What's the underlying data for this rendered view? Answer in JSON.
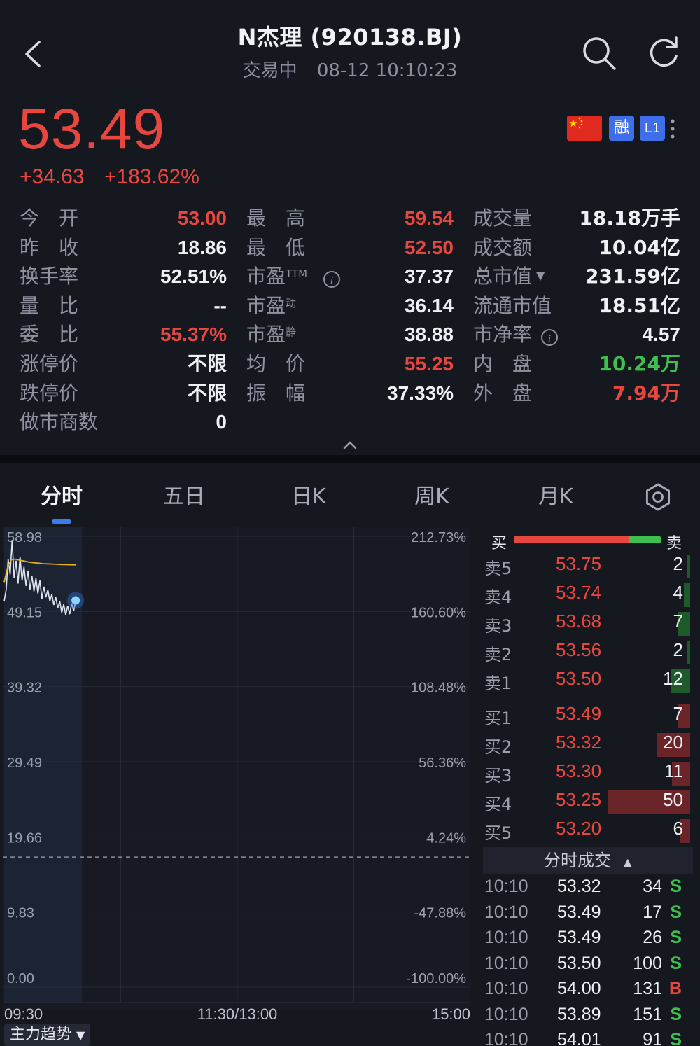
{
  "header": {
    "title": "N杰理 (920138.BJ)",
    "status": "交易中",
    "datetime": "08-12 10:10:23"
  },
  "quote": {
    "price": "53.49",
    "change": "+34.63",
    "change_pct": "+183.62%",
    "badges": {
      "margin": "融",
      "level": "L1"
    },
    "price_color": "#e8473f"
  },
  "stats": {
    "col1": [
      {
        "label": "今　开",
        "value": "53.00",
        "color": "red"
      },
      {
        "label": "昨　收",
        "value": "18.86",
        "color": "white"
      },
      {
        "label": "换手率",
        "value": "52.51%",
        "color": "white"
      },
      {
        "label": "量　比",
        "value": "--",
        "color": "white"
      },
      {
        "label": "委　比",
        "value": "55.37%",
        "color": "red"
      },
      {
        "label": "涨停价",
        "value": "不限",
        "color": "white"
      },
      {
        "label": "跌停价",
        "value": "不限",
        "color": "white"
      },
      {
        "label": "做市商数",
        "value": "0",
        "color": "white"
      }
    ],
    "col2": [
      {
        "label": "最　高",
        "value": "59.54",
        "color": "red"
      },
      {
        "label": "最　低",
        "value": "52.50",
        "color": "red"
      },
      {
        "label": "市盈",
        "sup": "TTM",
        "value": "37.37",
        "color": "white"
      },
      {
        "label": "市盈",
        "sup": "动",
        "value": "36.14",
        "color": "white"
      },
      {
        "label": "市盈",
        "sup": "静",
        "value": "38.88",
        "color": "white"
      },
      {
        "label": "均　价",
        "value": "55.25",
        "color": "red"
      },
      {
        "label": "振　幅",
        "value": "37.33%",
        "color": "white"
      }
    ],
    "col3": [
      {
        "label": "成交量",
        "value": "18.18万手",
        "color": "white"
      },
      {
        "label": "成交额",
        "value": "10.04亿",
        "color": "white"
      },
      {
        "label": "总市值",
        "value": "231.59亿",
        "color": "white"
      },
      {
        "label": "流通市值",
        "value": "18.51亿",
        "color": "white"
      },
      {
        "label": "市净率",
        "value": "4.57",
        "color": "white"
      },
      {
        "label": "内　盘",
        "value": "10.24万",
        "color": "green"
      },
      {
        "label": "外　盘",
        "value": "7.94万",
        "color": "red"
      }
    ]
  },
  "tabs": [
    "分时",
    "五日",
    "日K",
    "周K",
    "月K"
  ],
  "chart_data": {
    "type": "line",
    "y_left_ticks": [
      "58.98",
      "49.15",
      "39.32",
      "29.49",
      "19.66",
      "9.83",
      "0.00"
    ],
    "y_right_ticks": [
      "212.73%",
      "160.60%",
      "108.48%",
      "56.36%",
      "4.24%",
      "-47.88%",
      "-100.00%"
    ],
    "x_ticks": [
      "09:30",
      "11:30/13:00",
      "15:00"
    ],
    "ylim": [
      0,
      58.98
    ],
    "prev_close": 18.86,
    "session_minutes": 240,
    "price_series": [
      50.5,
      52.0,
      56.0,
      54.0,
      58.5,
      53.5,
      55.8,
      52.8,
      56.3,
      53.2,
      55.0,
      52.5,
      54.5,
      52.0,
      53.8,
      51.8,
      53.5,
      51.5,
      53.2,
      50.8,
      52.4,
      51.0,
      52.0,
      50.5,
      51.4,
      50.0,
      51.0,
      49.6,
      50.5,
      49.0,
      50.1,
      48.7,
      49.9,
      48.8,
      50.2,
      49.2,
      50.6
    ],
    "avg_series": [
      53.0,
      55.0,
      55.9,
      56.0,
      55.9,
      55.8,
      55.7,
      55.6,
      55.55,
      55.5,
      55.45,
      55.4,
      55.38,
      55.36,
      55.34,
      55.32,
      55.3,
      55.28,
      55.27,
      55.26,
      55.25
    ],
    "line_color": "#dfe3ee",
    "avg_color": "#e6b422"
  },
  "trend_button": "主力趋势",
  "orderbook": {
    "buy_label": "买",
    "sell_label": "卖",
    "buy_ratio": 0.78,
    "asks": [
      {
        "level": "卖5",
        "price": "53.75",
        "vol": "2",
        "vol_num": 2
      },
      {
        "level": "卖4",
        "price": "53.74",
        "vol": "4",
        "vol_num": 4
      },
      {
        "level": "卖3",
        "price": "53.68",
        "vol": "7",
        "vol_num": 7
      },
      {
        "level": "卖2",
        "price": "53.56",
        "vol": "2",
        "vol_num": 2
      },
      {
        "level": "卖1",
        "price": "53.50",
        "vol": "12",
        "vol_num": 12
      }
    ],
    "bids": [
      {
        "level": "买1",
        "price": "53.49",
        "vol": "7",
        "vol_num": 7
      },
      {
        "level": "买2",
        "price": "53.32",
        "vol": "20",
        "vol_num": 20
      },
      {
        "level": "买3",
        "price": "53.30",
        "vol": "11",
        "vol_num": 11
      },
      {
        "level": "买4",
        "price": "53.25",
        "vol": "50",
        "vol_num": 50
      },
      {
        "level": "买5",
        "price": "53.20",
        "vol": "6",
        "vol_num": 6
      }
    ]
  },
  "ticks": {
    "title": "分时成交",
    "rows": [
      {
        "time": "10:10",
        "price": "53.32",
        "vol": "34",
        "side": "S"
      },
      {
        "time": "10:10",
        "price": "53.49",
        "vol": "17",
        "side": "S"
      },
      {
        "time": "10:10",
        "price": "53.49",
        "vol": "26",
        "side": "S"
      },
      {
        "time": "10:10",
        "price": "53.50",
        "vol": "100",
        "side": "S"
      },
      {
        "time": "10:10",
        "price": "54.00",
        "vol": "131",
        "side": "B"
      },
      {
        "time": "10:10",
        "price": "53.89",
        "vol": "151",
        "side": "S"
      },
      {
        "time": "10:10",
        "price": "54.01",
        "vol": "91",
        "side": "S"
      }
    ]
  }
}
